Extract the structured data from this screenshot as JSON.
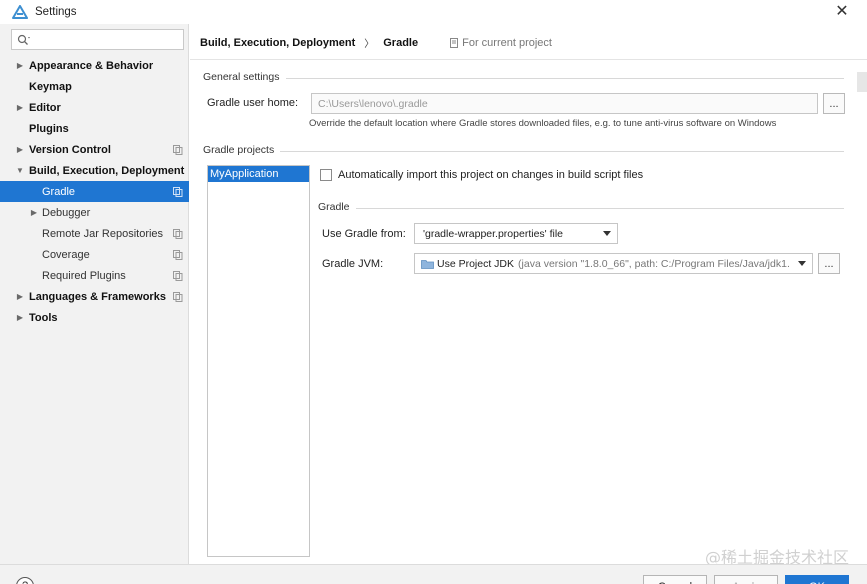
{
  "window": {
    "title": "Settings",
    "close_glyph": "✕"
  },
  "search": {
    "value": "",
    "placeholder": ""
  },
  "tree": [
    {
      "label": "Appearance & Behavior",
      "bold": true,
      "arrow": "right",
      "indent": 0,
      "copy_icon": false,
      "selected": false
    },
    {
      "label": "Keymap",
      "bold": true,
      "arrow": null,
      "indent": 0,
      "copy_icon": false,
      "selected": false
    },
    {
      "label": "Editor",
      "bold": true,
      "arrow": "right",
      "indent": 0,
      "copy_icon": false,
      "selected": false
    },
    {
      "label": "Plugins",
      "bold": true,
      "arrow": null,
      "indent": 0,
      "copy_icon": false,
      "selected": false
    },
    {
      "label": "Version Control",
      "bold": true,
      "arrow": "right",
      "indent": 0,
      "copy_icon": true,
      "selected": false
    },
    {
      "label": "Build, Execution, Deployment",
      "bold": true,
      "arrow": "down",
      "indent": 0,
      "copy_icon": false,
      "selected": false
    },
    {
      "label": "Gradle",
      "bold": false,
      "arrow": null,
      "indent": 2,
      "copy_icon": true,
      "selected": true
    },
    {
      "label": "Debugger",
      "bold": false,
      "arrow": "right",
      "indent": 1,
      "copy_icon": false,
      "selected": false
    },
    {
      "label": "Remote Jar Repositories",
      "bold": false,
      "arrow": null,
      "indent": 2,
      "copy_icon": true,
      "selected": false
    },
    {
      "label": "Coverage",
      "bold": false,
      "arrow": null,
      "indent": 2,
      "copy_icon": true,
      "selected": false
    },
    {
      "label": "Required Plugins",
      "bold": false,
      "arrow": null,
      "indent": 2,
      "copy_icon": true,
      "selected": false
    },
    {
      "label": "Languages & Frameworks",
      "bold": true,
      "arrow": "right",
      "indent": 0,
      "copy_icon": true,
      "selected": false
    },
    {
      "label": "Tools",
      "bold": true,
      "arrow": "right",
      "indent": 0,
      "copy_icon": false,
      "selected": false
    }
  ],
  "breadcrumb": {
    "parent": "Build, Execution, Deployment",
    "separator": "〉",
    "current": "Gradle",
    "scope": "For current project"
  },
  "general": {
    "section_title": "General settings",
    "user_home_label": "Gradle user home:",
    "user_home_value": "C:\\Users\\lenovo\\.gradle",
    "browse_label": "...",
    "hint": "Override the default location where Gradle stores downloaded files, e.g. to tune anti-virus software on Windows"
  },
  "projects": {
    "section_title": "Gradle projects",
    "items": [
      "MyApplication"
    ],
    "auto_import_label": "Automatically import this project on changes in build script files",
    "auto_import_checked": false
  },
  "gradle": {
    "section_title": "Gradle",
    "use_from_label": "Use Gradle from:",
    "use_from_value": "'gradle-wrapper.properties' file",
    "jvm_label": "Gradle JVM:",
    "jvm_value_main": "Use Project JDK",
    "jvm_value_detail": "(java version \"1.8.0_66\", path: C:/Program Files/Java/jdk1.",
    "jvm_browse_label": "..."
  },
  "footer": {
    "help_label": "?",
    "cancel_label": "Cancel",
    "apply_label": "Apply",
    "ok_label": "OK"
  },
  "watermark": "@稀土掘金技术社区",
  "colors": {
    "accent": "#1f76d2",
    "sidebar_bg": "#f2f2f2"
  }
}
